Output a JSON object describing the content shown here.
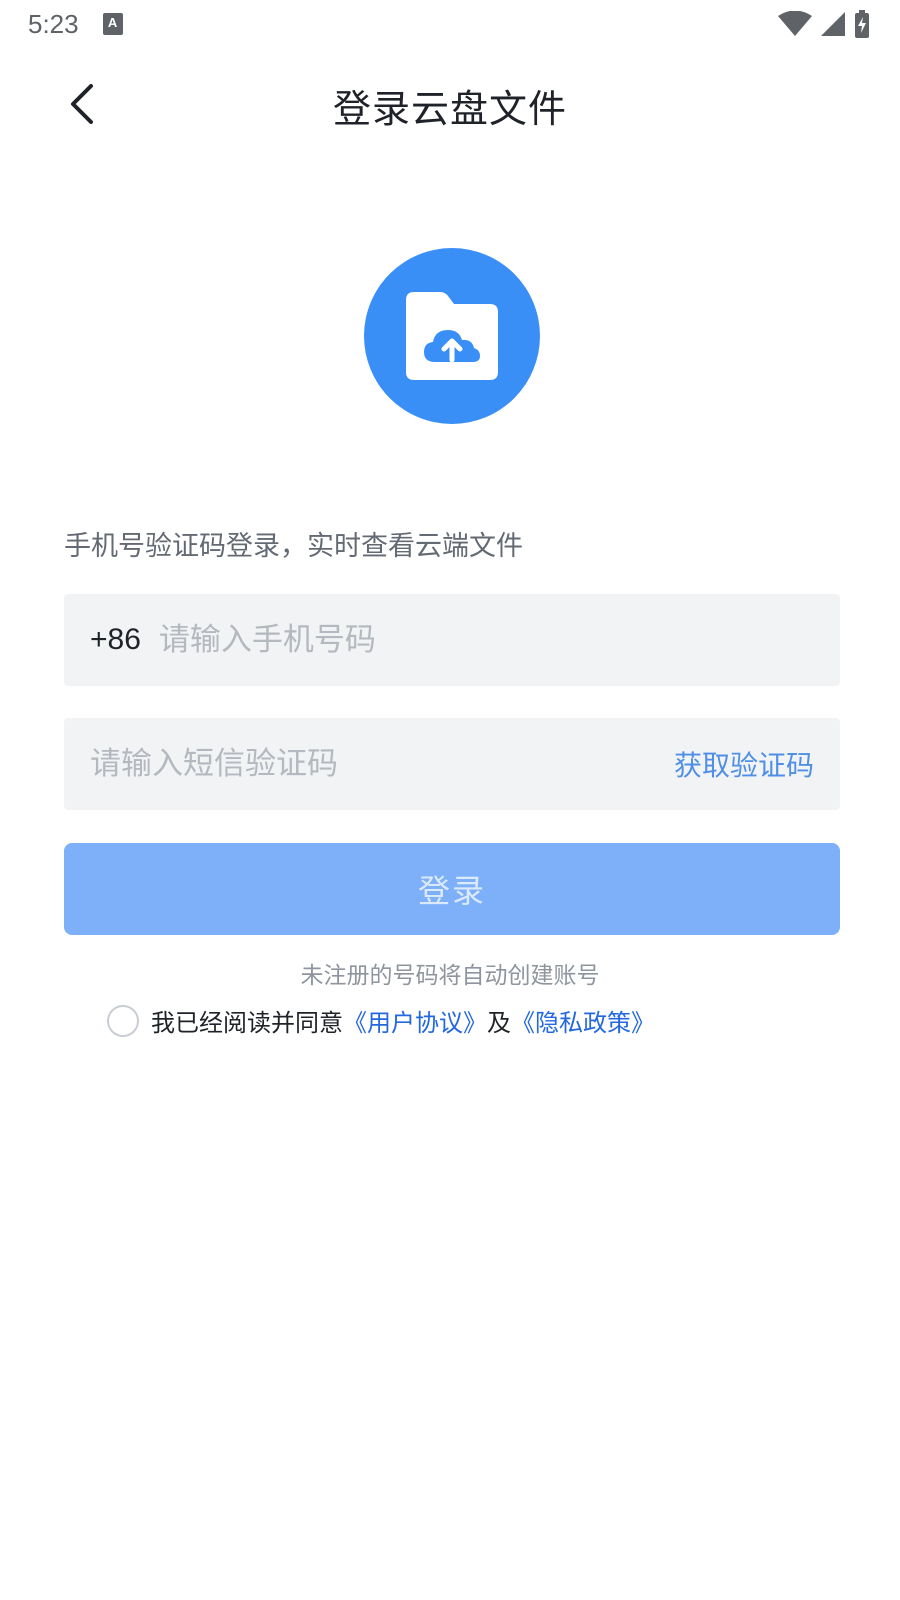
{
  "status_bar": {
    "time": "5:23",
    "notification_icon": "A"
  },
  "header": {
    "title": "登录云盘文件"
  },
  "logo": {
    "icon": "cloud-upload-folder-icon",
    "color": "#3a8ff7"
  },
  "subtitle": "手机号验证码登录，实时查看云端文件",
  "phone_field": {
    "country_code": "+86",
    "placeholder": "请输入手机号码",
    "value": ""
  },
  "code_field": {
    "placeholder": "请输入短信验证码",
    "value": "",
    "get_code_label": "获取验证码"
  },
  "login_button": {
    "label": "登录",
    "color": "#7db0f8"
  },
  "hint": "未注册的号码将自动创建账号",
  "agreement": {
    "prefix": "我已经阅读并同意",
    "user_agreement": "《用户协议》",
    "and": "及",
    "privacy_policy": "《隐私政策》",
    "link_color": "#2468e0"
  }
}
